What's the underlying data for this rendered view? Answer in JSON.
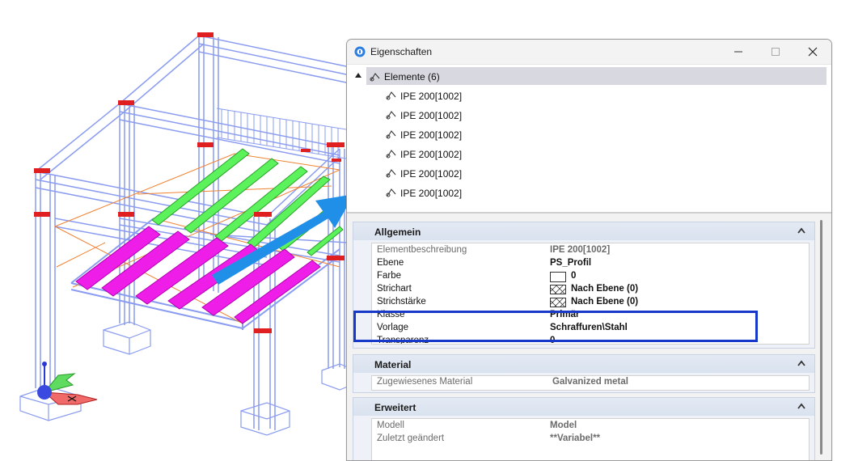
{
  "window": {
    "title": "Eigenschaften",
    "icon": "properties-icon",
    "buttons": [
      "minimize-icon",
      "maximize-icon",
      "close-icon"
    ]
  },
  "tree": {
    "root_label": "Elemente (6)",
    "items": [
      "IPE 200[1002]",
      "IPE 200[1002]",
      "IPE 200[1002]",
      "IPE 200[1002]",
      "IPE 200[1002]",
      "IPE 200[1002]"
    ]
  },
  "groups": {
    "allgemein": {
      "title": "Allgemein",
      "rows": [
        {
          "key": "Elementbeschreibung",
          "value": "IPE 200[1002]"
        },
        {
          "key": "Ebene",
          "value": "PS_Profil"
        },
        {
          "key": "Farbe",
          "value": "0"
        },
        {
          "key": "Strichart",
          "value": "Nach Ebene (0)"
        },
        {
          "key": "Strichstärke",
          "value": "Nach Ebene (0)"
        },
        {
          "key": "Klasse",
          "value": "Primär"
        },
        {
          "key": "Vorlage",
          "value": "Schraffuren\\Stahl"
        },
        {
          "key": "Transparenz",
          "value": "0"
        }
      ]
    },
    "material": {
      "title": "Material",
      "rows": [
        {
          "key": "Zugewiesenes Material",
          "value": "Galvanized metal"
        }
      ]
    },
    "erweitert": {
      "title": "Erweitert",
      "rows": [
        {
          "key": "Modell",
          "value": "Model"
        },
        {
          "key": "Zuletzt geändert",
          "value": "**Variabel**"
        }
      ]
    }
  },
  "colors": {
    "frame": "#8a9cf0",
    "beam_magenta": "#ee1ee8",
    "beam_green": "#5cf25c",
    "brace_orange": "#f08232",
    "arrow": "#1f8fe8",
    "highlight": "#1639c9",
    "joint_red": "#e02020"
  }
}
